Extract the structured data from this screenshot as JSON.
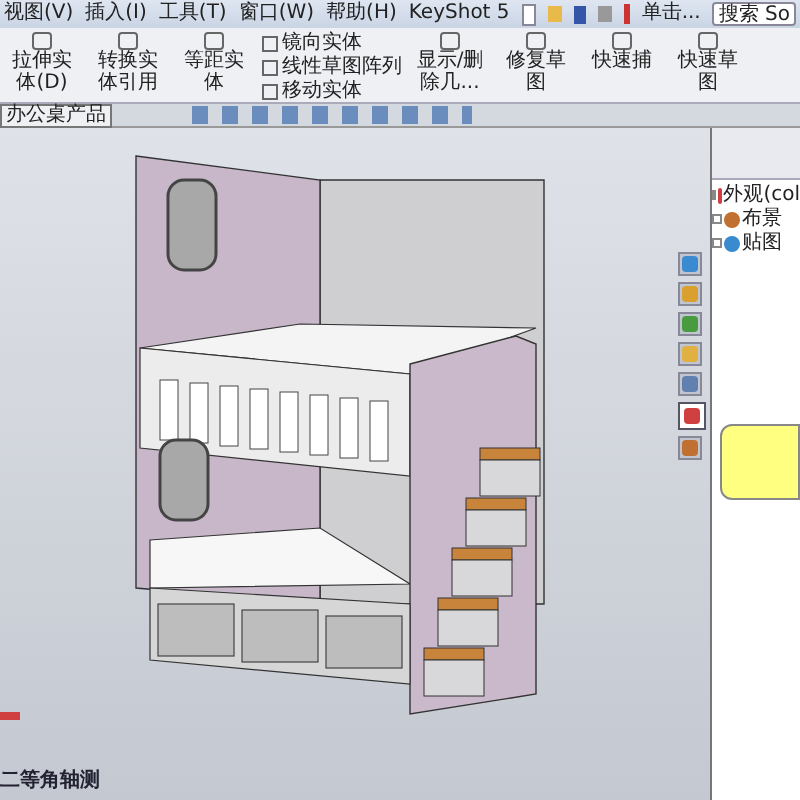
{
  "menu": [
    {
      "label": "视图(V)"
    },
    {
      "label": "插入(I)"
    },
    {
      "label": "工具(T)"
    },
    {
      "label": "窗口(W)"
    },
    {
      "label": "帮助(H)"
    },
    {
      "label": "KeyShot 5"
    }
  ],
  "quick_bar": {
    "hint": "单击...",
    "search": "搜索 So"
  },
  "ribbon": [
    {
      "kind": "large",
      "label": "拉伸实体(D)"
    },
    {
      "kind": "large",
      "label": "转换实体引用"
    },
    {
      "kind": "large",
      "label": "等距实体"
    },
    {
      "kind": "stack",
      "items": [
        "镜向实体",
        "线性草图阵列",
        "移动实体"
      ]
    },
    {
      "kind": "large",
      "label": "显示/删除几..."
    },
    {
      "kind": "large",
      "label": "修复草图"
    },
    {
      "kind": "large",
      "label": "快速捕"
    },
    {
      "kind": "large",
      "label": "快速草图"
    }
  ],
  "doc_tab": "办公桌产品",
  "side_tabs": [
    {
      "selected": false
    },
    {
      "selected": false
    },
    {
      "selected": false
    },
    {
      "selected": false
    },
    {
      "selected": false
    },
    {
      "selected": true
    },
    {
      "selected": false
    }
  ],
  "appearance_tree": [
    {
      "label": "外观(col"
    },
    {
      "label": "布景"
    },
    {
      "label": "贴图"
    }
  ],
  "view_label": "二等角轴测"
}
